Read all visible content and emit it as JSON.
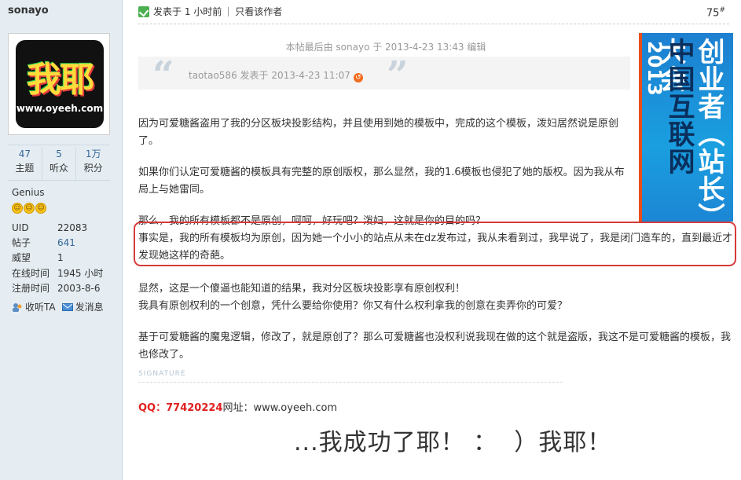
{
  "sidebar": {
    "username": "sonayo",
    "avatar_title": "我耶",
    "avatar_url": "www.oyeeh.com",
    "stats": [
      {
        "value": "47",
        "label": "主题"
      },
      {
        "value": "5",
        "label": "听众"
      },
      {
        "value": "1万",
        "label": "积分"
      }
    ],
    "rank": "Genius",
    "info": [
      {
        "key": "UID",
        "value": "22083"
      },
      {
        "key": "帖子",
        "value": "641"
      },
      {
        "key": "威望",
        "value": "1"
      },
      {
        "key": "在线时间",
        "value": "1945 小时"
      },
      {
        "key": "注册时间",
        "value": "2003-8-6"
      }
    ],
    "follow_label": "收听TA",
    "message_label": "发消息"
  },
  "post": {
    "posted_time": "发表于 1 小时前",
    "author_only": "只看该作者",
    "floor": "75",
    "floor_mark": "#",
    "edited_note": "本帖最后由 sonayo 于 2013-4-23 13:43 编辑",
    "quote": "taotao586 发表于 2013-4-23 11:07",
    "paragraphs": {
      "p1": "因为可爱糖酱盗用了我的分区板块投影结构，并且使用到她的模板中，完成的这个模板，泼妇居然说是原创了。",
      "p2": "如果你们认定可爱糖酱的模板具有完整的原创版权，那么显然，我的1.6模板也侵犯了她的版权。因为我从布局上与她雷同。",
      "p3": "那么，我的所有模板都不是原创，呵呵，好玩吧？泼妇，这就是你的目的吗？",
      "p4": "事实是，我的所有模板均为原创，因为她一个小小的站点从未在dz发布过，我从未看到过，我早说了，我是闭门造车的，直到最近才发现她这样的奇葩。",
      "p5a": "显然，这是一个傻逼也能知道的结果，我对分区板块投影享有原创权利！",
      "p5b": "我具有原创权利的一个创意，凭什么要给你使用？你又有什么权利拿我的创意在卖弄你的可爱？",
      "p6": "基于可爱糖酱的魔鬼逻辑，修改了，就是原创了？那么可爱糖酱也没权利说我现在做的这个就是盗版，我这不是可爱糖酱的模板，我也修改了。"
    },
    "signature_label": "SIGNATURE",
    "sig_qq_label": "QQ：77420224",
    "sig_site": "网址：www.oyeeh.com",
    "sig_motto": "...我成功了耶！ ：  ）我耶！"
  },
  "ad": {
    "line1": "创业者（站长）大会",
    "line2": "中国互联网",
    "line3": "2013"
  },
  "colors": {
    "sidebar_bg": "#e5edf2",
    "link": "#336699",
    "highlight_border": "#d63a3a",
    "qq_red": "#e02020",
    "ad_blue": "#1a9fe0"
  }
}
